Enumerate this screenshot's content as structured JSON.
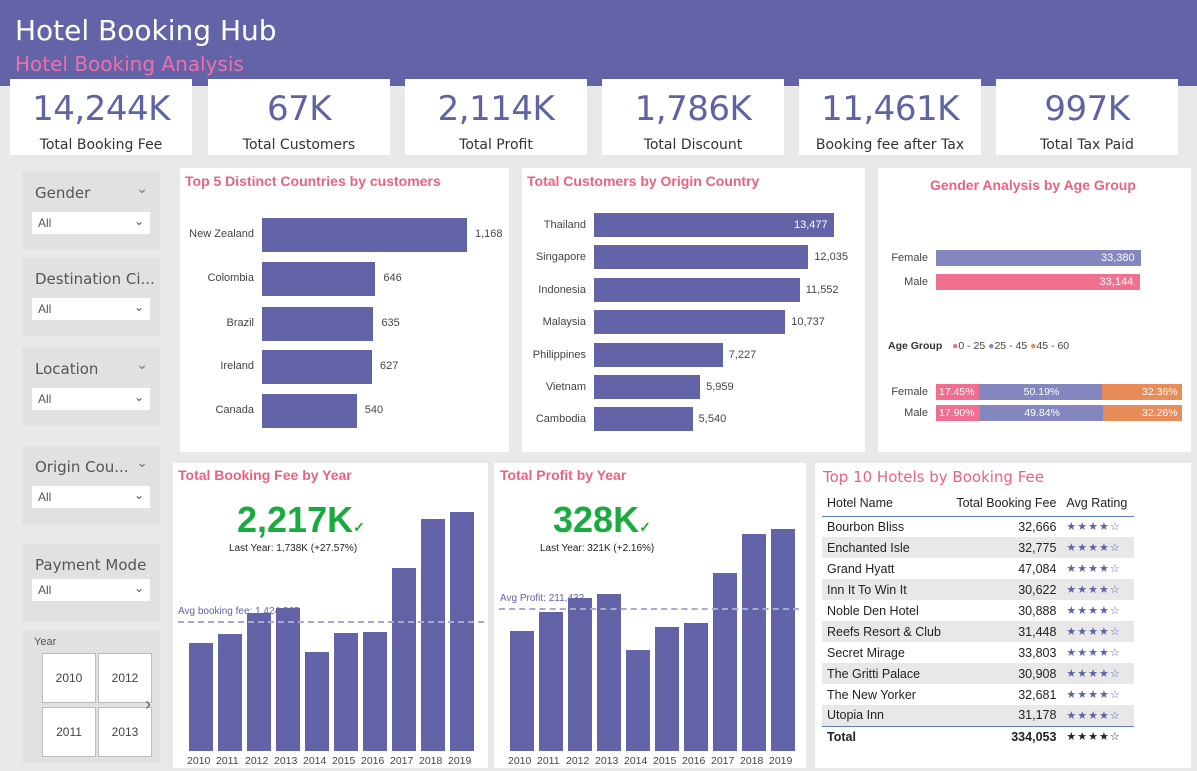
{
  "header": {
    "title": "Hotel Booking Hub",
    "subtitle": "Hotel Booking Analysis"
  },
  "kpis": [
    {
      "value": "14,244K",
      "label": "Total Booking Fee"
    },
    {
      "value": "67K",
      "label": "Total Customers"
    },
    {
      "value": "2,114K",
      "label": "Total Profit"
    },
    {
      "value": "1,786K",
      "label": "Total Discount"
    },
    {
      "value": "11,461K",
      "label": "Booking fee after Tax"
    },
    {
      "value": "997K",
      "label": "Total Tax Paid"
    }
  ],
  "slicers": [
    {
      "title": "Gender",
      "value": "All"
    },
    {
      "title": "Destination Ci...",
      "value": "All"
    },
    {
      "title": "Location",
      "value": "All"
    },
    {
      "title": "Origin Cou...",
      "value": "All"
    },
    {
      "title": "Payment Mode",
      "value": "All"
    }
  ],
  "year_slicer": {
    "title": "Year",
    "years": [
      "2010",
      "2012",
      "2011",
      "2013"
    ]
  },
  "colors": {
    "primary": "#6264a7",
    "pink": "#f06e8f",
    "orange": "#e88c5a",
    "kpi_green": "#1aab40",
    "title_pink": "#e8637f"
  },
  "chart_data": [
    {
      "type": "bar",
      "title": "Top 5 Distinct Countries by customers",
      "categories": [
        "New Zealand",
        "Colombia",
        "Brazil",
        "Ireland",
        "Canada"
      ],
      "values": [
        1168,
        646,
        635,
        627,
        540
      ],
      "labels": [
        "1,168",
        "646",
        "635",
        "627",
        "540"
      ]
    },
    {
      "type": "bar",
      "title": "Total Customers by Origin Country",
      "categories": [
        "Thailand",
        "Singapore",
        "Indonesia",
        "Malaysia",
        "Philippines",
        "Vietnam",
        "Cambodia"
      ],
      "values": [
        13477,
        12035,
        11552,
        10737,
        7227,
        5959,
        5540
      ],
      "labels": [
        "13,477",
        "12,035",
        "11,552",
        "10,737",
        "7,227",
        "5,959",
        "5,540"
      ]
    },
    {
      "type": "bar",
      "title": "Gender Analysis by Age Group",
      "categories": [
        "Female",
        "Male"
      ],
      "values": [
        33380,
        33144
      ],
      "labels": [
        "33,380",
        "33,144"
      ],
      "legend_title": "Age Group",
      "age_groups": [
        "0 - 25",
        "25 - 45",
        "45 - 60"
      ],
      "stacked": [
        {
          "name": "Female",
          "values": [
            17.45,
            50.19,
            32.36
          ],
          "labels": [
            "17.45%",
            "50.19%",
            "32.36%"
          ]
        },
        {
          "name": "Male",
          "values": [
            17.9,
            49.84,
            32.26
          ],
          "labels": [
            "17.90%",
            "49.84%",
            "32.26%"
          ]
        }
      ]
    },
    {
      "type": "bar",
      "title": "Total Booking Fee by Year",
      "categories": [
        "2010",
        "2011",
        "2012",
        "2013",
        "2014",
        "2015",
        "2016",
        "2017",
        "2018",
        "2019"
      ],
      "values": [
        1190,
        1290,
        1520,
        1570,
        1085,
        1300,
        1310,
        2010,
        2550,
        2620
      ],
      "ylim": [
        0,
        2900
      ],
      "kpi": "2,217K",
      "kpi_sub": "Last Year: 1,738K (+27.57%)",
      "avg_label": "Avg booking fee: 1,424,365",
      "avg_value": 1424.365
    },
    {
      "type": "bar",
      "title": "Total Profit by Year",
      "categories": [
        "2010",
        "2011",
        "2012",
        "2013",
        "2014",
        "2015",
        "2016",
        "2017",
        "2018",
        "2019"
      ],
      "values": [
        178,
        205,
        226,
        232,
        150,
        183,
        189,
        264,
        321,
        328
      ],
      "ylim": [
        0,
        370
      ],
      "kpi": "328K",
      "kpi_sub": "Last Year: 321K (+2.16%)",
      "avg_label": "Avg Profit: 211,432",
      "avg_value": 211.432
    }
  ],
  "hotels_table": {
    "title": "Top 10 Hotels by Booking Fee",
    "columns": [
      "Hotel Name",
      "Total Booking Fee",
      "Avg Rating"
    ],
    "rows": [
      {
        "name": "Bourbon Bliss",
        "fee": "32,666",
        "stars": "★★★★☆"
      },
      {
        "name": "Enchanted Isle",
        "fee": "32,775",
        "stars": "★★★★☆"
      },
      {
        "name": "Grand Hyatt",
        "fee": "47,084",
        "stars": "★★★★☆"
      },
      {
        "name": "Inn It To Win It",
        "fee": "30,622",
        "stars": "★★★★☆"
      },
      {
        "name": "Noble Den Hotel",
        "fee": "30,888",
        "stars": "★★★★☆"
      },
      {
        "name": "Reefs Resort & Club",
        "fee": "31,448",
        "stars": "★★★★☆"
      },
      {
        "name": "Secret Mirage",
        "fee": "33,803",
        "stars": "★★★★☆"
      },
      {
        "name": "The Gritti Palace",
        "fee": "30,908",
        "stars": "★★★★☆"
      },
      {
        "name": "The New Yorker",
        "fee": "32,681",
        "stars": "★★★★☆"
      },
      {
        "name": "Utopia Inn",
        "fee": "31,178",
        "stars": "★★★★☆"
      }
    ],
    "total_label": "Total",
    "total_fee": "334,053",
    "total_stars": "★★★★☆"
  }
}
